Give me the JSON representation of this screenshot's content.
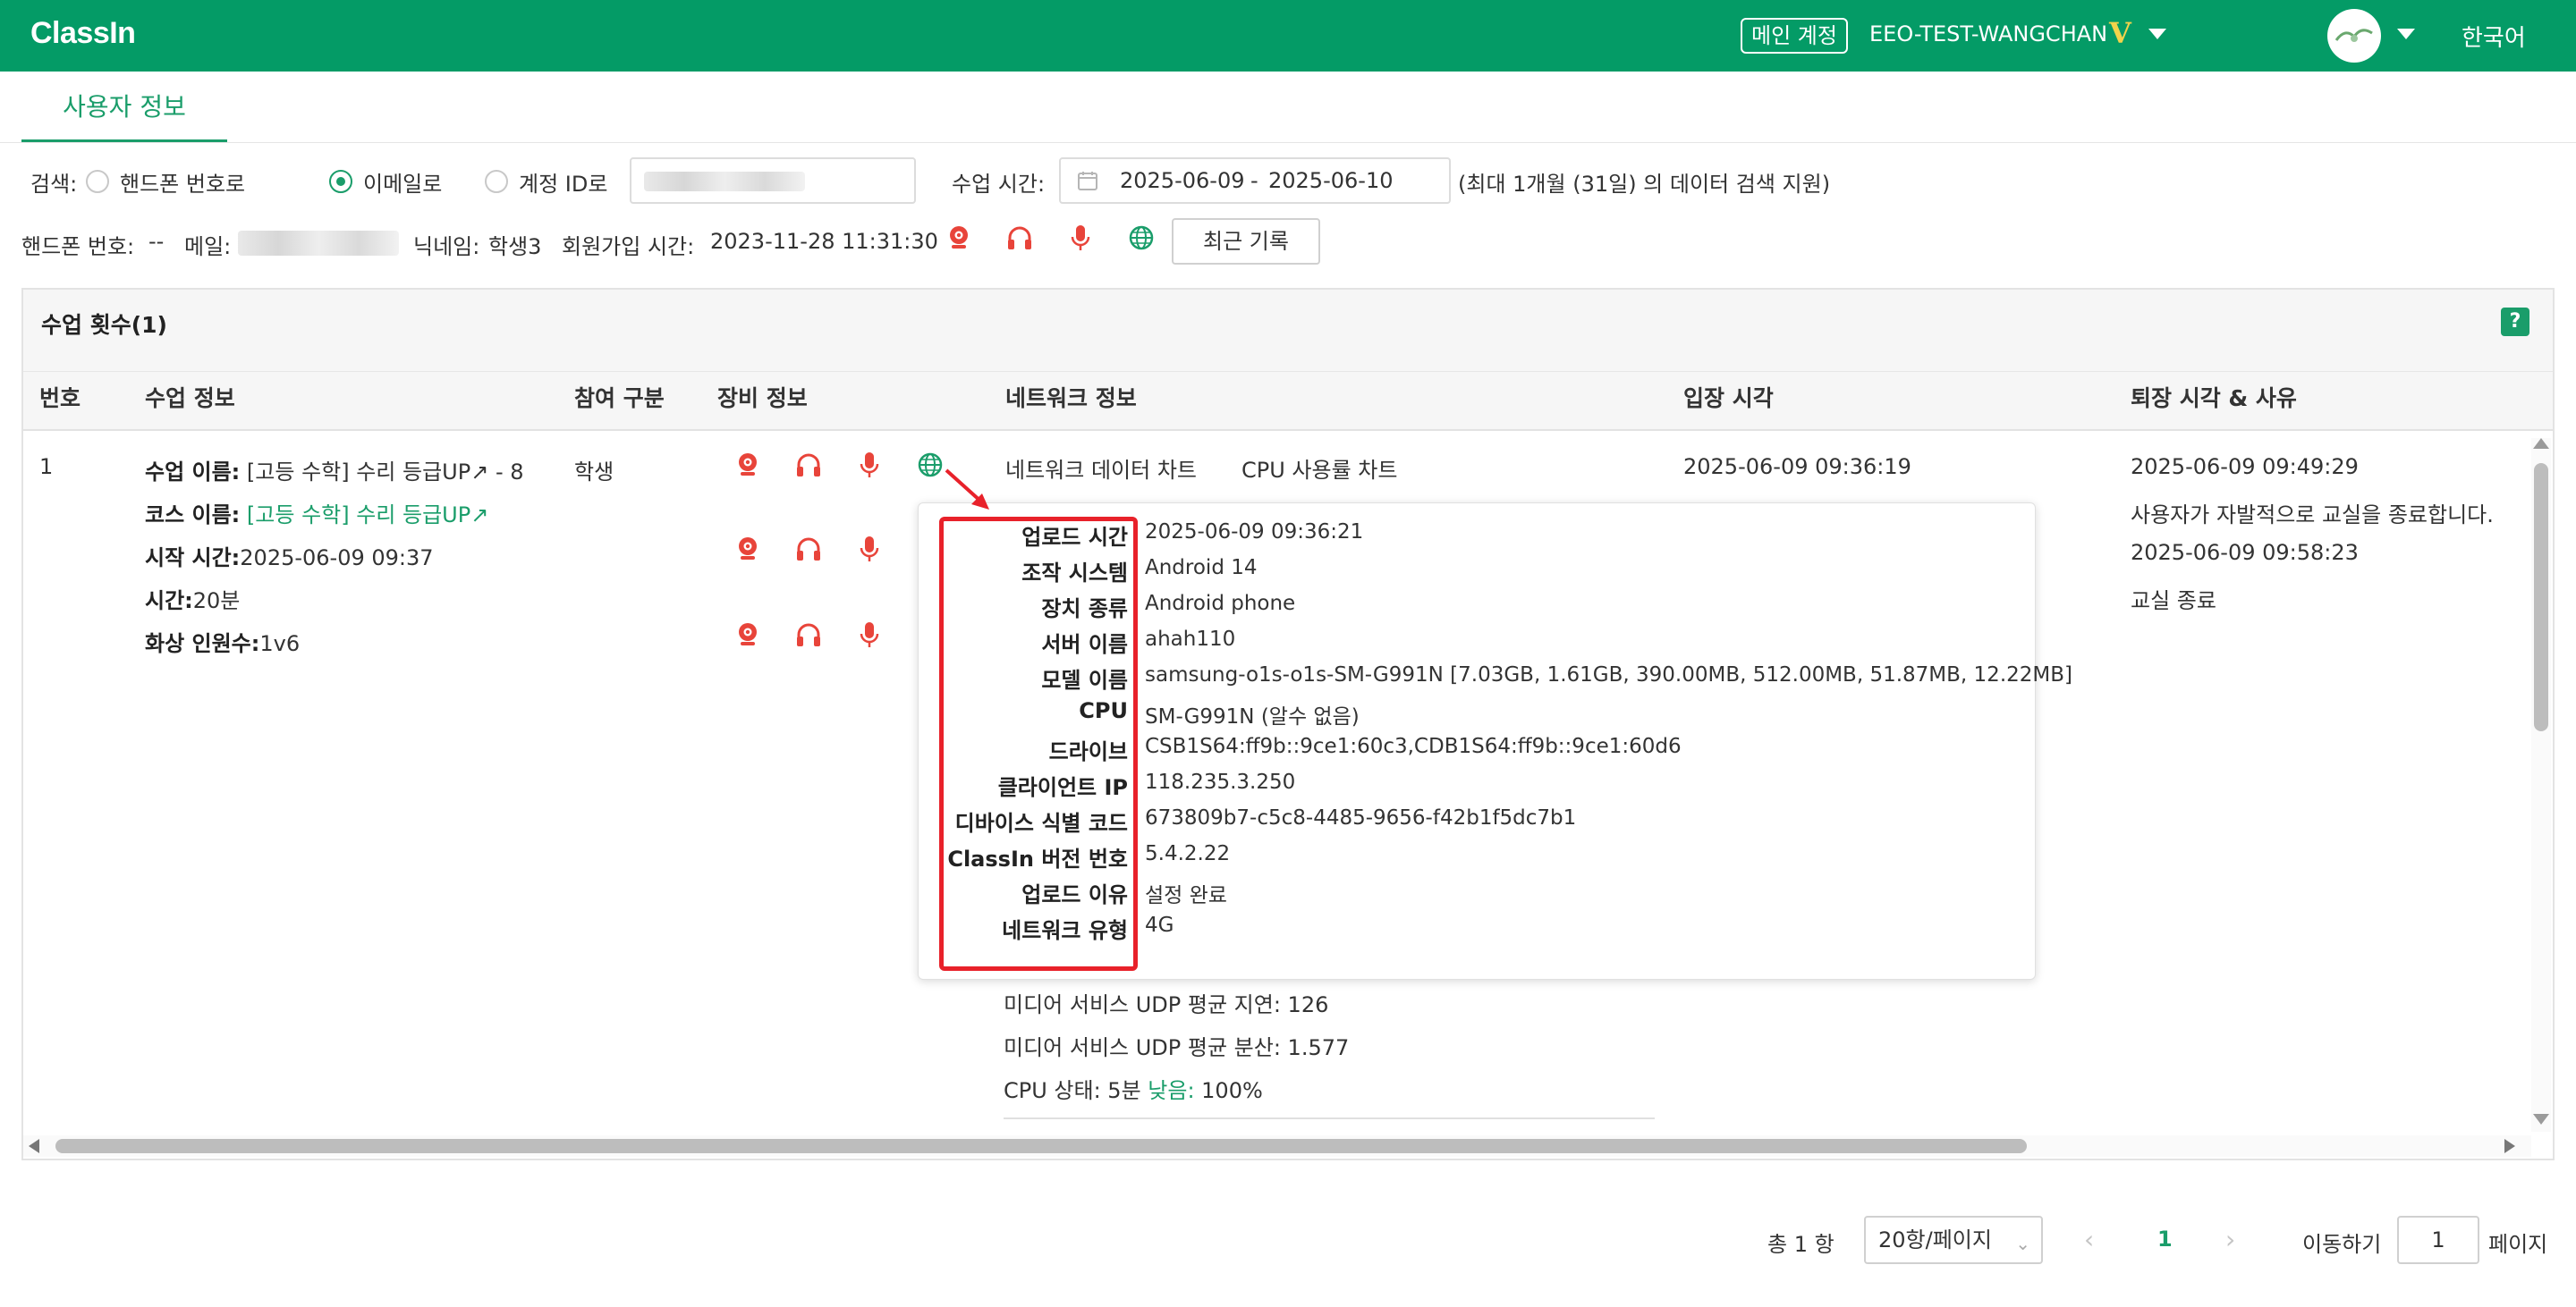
{
  "header": {
    "logo": "ClassIn",
    "account_badge": "메인 계정",
    "account_name": "EEO-TEST-WANGCHAN",
    "vip_badge": "V",
    "language": "한국어"
  },
  "tabs": [
    {
      "label": "사용자 정보"
    }
  ],
  "search": {
    "label": "검색:",
    "options": [
      "핸드폰 번호로",
      "이메일로",
      "계정 ID로"
    ],
    "selected": "이메일로",
    "time_label": "수업 시간:",
    "date_from": "2025-06-09",
    "date_sep": "-",
    "date_to": "2025-06-10",
    "hint": "(최대 1개월 (31일) 의 데이터 검색 지원)"
  },
  "user_info": {
    "phone_label": "핸드폰 번호:",
    "phone_value": "--",
    "email_label": "메일:",
    "nickname_label": "닉네임:",
    "nickname_value": "학생3",
    "signup_label": "회원가입 시간:",
    "signup_value": "2023-11-28 11:31:30",
    "recent_button": "최근 기록"
  },
  "card": {
    "title": "수업 횟수(1)",
    "help": "?",
    "columns": [
      "번호",
      "수업 정보",
      "참여 구분",
      "장비 정보",
      "네트워크 정보",
      "입장 시각",
      "퇴장 시각 & 사유"
    ]
  },
  "row": {
    "number": "1",
    "lesson_name_label": "수업 이름:",
    "lesson_name_value": "[고등 수학] 수리 등급UP↗ - 8",
    "course_name_label": "코스 이름:",
    "course_name_value": "[고등 수학] 수리 등급UP↗",
    "start_label": "시작 시간:",
    "start_value": "2025-06-09 09:37",
    "duration_label": "시간:",
    "duration_value": "20분",
    "video_label": "화상 인원수:",
    "video_value": "1v6",
    "role": "학생",
    "network_chart_link": "네트워크 데이터 차트",
    "cpu_chart_link": "CPU 사용률 차트",
    "udp_delay": "미디어 서비스 UDP 평균 지연: 126",
    "udp_variance": "미디어 서비스 UDP 평균 분산: 1.577",
    "cpu_status_prefix": "CPU 상태: 5분 ",
    "cpu_status_low": "낮음:",
    "cpu_status_value": " 100%",
    "enter_time": "2025-06-09 09:36:19",
    "exit_time_1": "2025-06-09 09:49:29",
    "exit_reason_1": "사용자가 자발적으로 교실을 종료합니다.",
    "exit_time_2": "2025-06-09 09:58:23",
    "exit_reason_2": "교실 종료"
  },
  "popover": {
    "items": [
      {
        "key": "업로드 시간",
        "value": "2025-06-09 09:36:21"
      },
      {
        "key": "조작 시스템",
        "value": "Android 14"
      },
      {
        "key": "장치 종류",
        "value": "Android phone"
      },
      {
        "key": "서버 이름",
        "value": "ahah110"
      },
      {
        "key": "모델 이름",
        "value": "samsung-o1s-o1s-SM-G991N [7.03GB, 1.61GB, 390.00MB, 512.00MB, 51.87MB, 12.22MB]"
      },
      {
        "key": "CPU",
        "value": "SM-G991N (알수 없음)"
      },
      {
        "key": "드라이브",
        "value": "CSB1S64:ff9b::9ce1:60c3,CDB1S64:ff9b::9ce1:60d6"
      },
      {
        "key": "클라이언트 IP",
        "value": "118.235.3.250"
      },
      {
        "key": "디바이스 식별 코드",
        "value": "673809b7-c5c8-4485-9656-f42b1f5dc7b1"
      },
      {
        "key": "ClassIn 버전 번호",
        "value": "5.4.2.22"
      },
      {
        "key": "업로드 이유",
        "value": "설정 완료"
      },
      {
        "key": "네트워크 유형",
        "value": "4G"
      }
    ]
  },
  "pagination": {
    "total": "총 1 항",
    "page_size": "20항/페이지",
    "current_page": "1",
    "goto_label": "이동하기",
    "goto_value": "1",
    "page_suffix": "페이지"
  },
  "colors": {
    "brand": "#049b66",
    "accent": "#1a9d6a",
    "device_icon": "#e8443a",
    "highlight": "#e8212a"
  }
}
